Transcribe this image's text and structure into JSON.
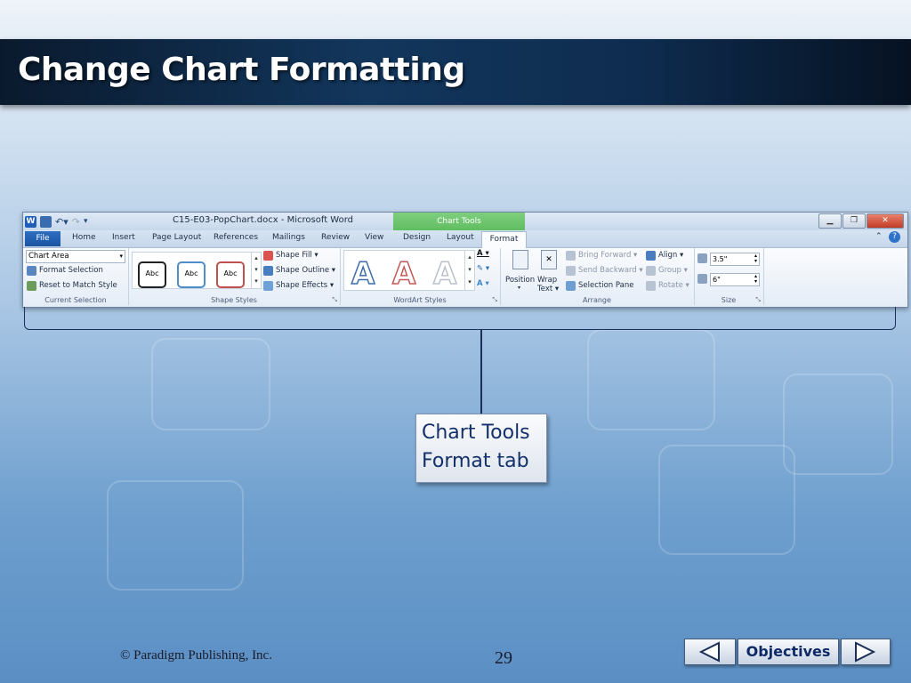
{
  "slide": {
    "title": "Change Chart Formatting",
    "callout_line1": "Chart Tools",
    "callout_line2": "Format tab",
    "copyright": "© Paradigm Publishing, Inc.",
    "page_number": "29",
    "nav_objectives": "Objectives"
  },
  "word": {
    "doc_title": "C15-E03-PopChart.docx - Microsoft Word",
    "contextual_tab": "Chart Tools",
    "tabs": [
      "File",
      "Home",
      "Insert",
      "Page Layout",
      "References",
      "Mailings",
      "Review",
      "View",
      "Design",
      "Layout",
      "Format"
    ],
    "current_selection": {
      "dropdown_value": "Chart Area",
      "format_selection": "Format Selection",
      "reset_style": "Reset to Match Style",
      "label": "Current Selection"
    },
    "shape_styles": {
      "presets": [
        "Abc",
        "Abc",
        "Abc"
      ],
      "fill": "Shape Fill",
      "outline": "Shape Outline",
      "effects": "Shape Effects",
      "label": "Shape Styles"
    },
    "wordart": {
      "samples": [
        "A",
        "A",
        "A"
      ],
      "label": "WordArt Styles"
    },
    "arrange": {
      "position": "Position",
      "wrap_line1": "Wrap",
      "wrap_line2": "Text",
      "bring_forward": "Bring Forward",
      "send_backward": "Send Backward",
      "selection_pane": "Selection Pane",
      "align": "Align",
      "group": "Group",
      "rotate": "Rotate",
      "label": "Arrange"
    },
    "size": {
      "height": "3.5\"",
      "width": "6\"",
      "label": "Size"
    }
  },
  "colors": {
    "title_text": "#ffffff",
    "callout_text": "#13306a",
    "chart_tools_green": "#5dbb5d",
    "file_tab_blue": "#1a55a3"
  }
}
